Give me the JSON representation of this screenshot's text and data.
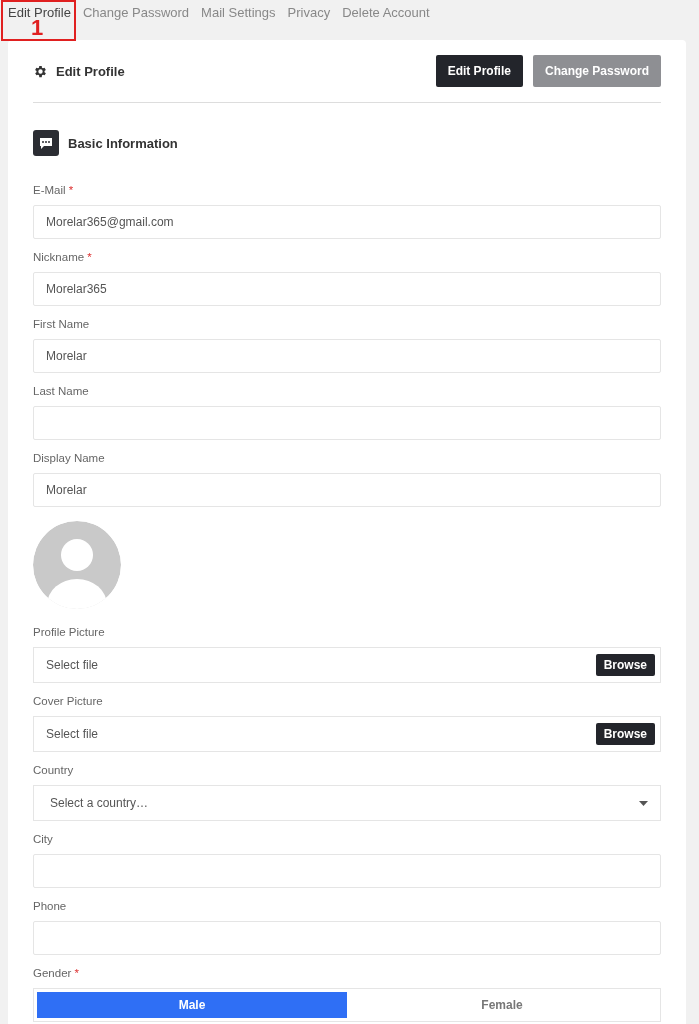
{
  "tabs": [
    {
      "label": "Edit Profile",
      "selected": true
    },
    {
      "label": "Change Password",
      "selected": false
    },
    {
      "label": "Mail Settings",
      "selected": false
    },
    {
      "label": "Privacy",
      "selected": false
    },
    {
      "label": "Delete Account",
      "selected": false
    }
  ],
  "annotation": {
    "label": "1"
  },
  "header": {
    "title": "Edit Profile",
    "buttons": [
      {
        "label": "Edit Profile",
        "selected": true
      },
      {
        "label": "Change Password",
        "selected": false
      }
    ]
  },
  "section": {
    "title": "Basic Information"
  },
  "fields": [
    {
      "kind": "text",
      "label": "E-Mail",
      "required_mark": "*",
      "value": "Morelar365@gmail.com"
    },
    {
      "kind": "text",
      "label": "Nickname",
      "required_mark": "*",
      "value": "Morelar365"
    },
    {
      "kind": "text",
      "label": "First Name",
      "value": "Morelar"
    },
    {
      "kind": "text",
      "label": "Last Name"
    },
    {
      "kind": "text",
      "label": "Display Name",
      "value": "Morelar"
    },
    {
      "kind": "avatar"
    },
    {
      "kind": "file",
      "label": "Profile Picture",
      "placeholder": "Select file",
      "button": "Browse"
    },
    {
      "kind": "file",
      "label": "Cover Picture",
      "placeholder": "Select file",
      "button": "Browse"
    },
    {
      "kind": "select",
      "label": "Country",
      "placeholder": "Select a country…"
    },
    {
      "kind": "text",
      "label": "City"
    },
    {
      "kind": "text",
      "label": "Phone"
    },
    {
      "kind": "toggle",
      "label": "Gender",
      "required_mark": "*",
      "options": [
        {
          "label": "Male",
          "selected": true
        },
        {
          "label": "Female",
          "selected": false
        }
      ]
    }
  ]
}
